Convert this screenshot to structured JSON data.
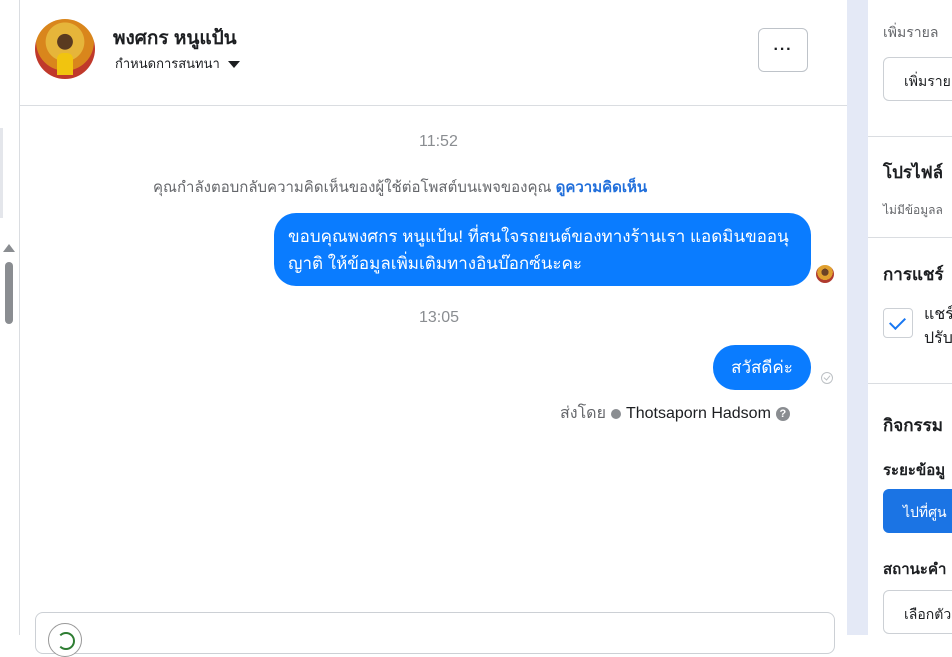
{
  "conversation": {
    "contact_name": "พงศกร หนูแป้น",
    "assign_label": "กำหนดการสนทนา",
    "more_label": "···"
  },
  "messages": {
    "time_1": "11:52",
    "system_note": "คุณกำลังตอบกลับความคิดเห็นของผู้ใช้ต่อโพสต์บนเพจของคุณ",
    "system_link": "ดูความคิดเห็น",
    "msg_1": "ขอบคุณพงศกร หนูแป้น! ที่สนใจรถยนต์ของทางร้านเรา แอดมินขออนุญาติ ให้ข้อมูลเพิ่มเติมทางอินบ๊อกซ์นะคะ",
    "time_2": "13:05",
    "msg_2": "สวัสดีค่ะ",
    "sent_by_label": "ส่งโดย",
    "sent_by_agent": "Thotsaporn Hadsom",
    "help_glyph": "?"
  },
  "right_panel": {
    "add_details_label": "เพิ่มรายล",
    "add_details_input": "เพิ่มราย",
    "profile_heading": "โปรไฟล์",
    "profile_note": "ไม่มีข้อมูลล",
    "share_heading": "การแชร์",
    "share_option_line1": "แชร์",
    "share_option_line2": "ปรับ",
    "activity_heading": "กิจกรรม",
    "range_label": "ระยะข้อมู",
    "go_button": "ไปที่ศูน",
    "status_label": "สถานะคำ",
    "select_placeholder": "เลือกตัว"
  },
  "colors": {
    "bubble": "#0a7cff",
    "link": "#216fdb",
    "primary_button": "#1b74e4",
    "panel_band": "#e4e9f6"
  }
}
